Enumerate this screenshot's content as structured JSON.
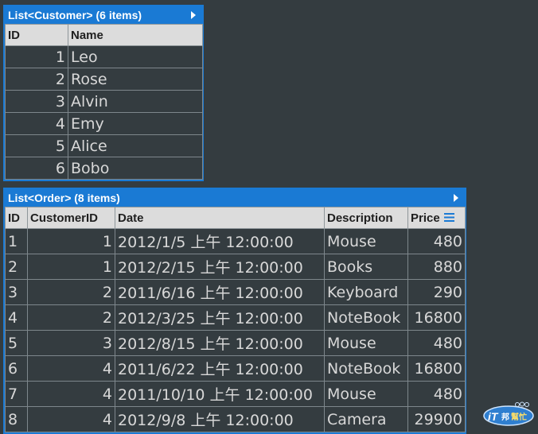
{
  "customer_panel": {
    "title": "List<Customer> (6 items)",
    "columns": [
      "ID",
      "Name"
    ],
    "rows": [
      [
        "1",
        "Leo"
      ],
      [
        "2",
        "Rose"
      ],
      [
        "3",
        "Alvin"
      ],
      [
        "4",
        "Emy"
      ],
      [
        "5",
        "Alice"
      ],
      [
        "6",
        "Bobo"
      ]
    ]
  },
  "order_panel": {
    "title": "List<Order> (8 items)",
    "columns": [
      "ID",
      "CustomerID",
      "Date",
      "Description",
      "Price"
    ],
    "rows": [
      [
        "1",
        "1",
        "2012/1/5 上午 12:00:00",
        "Mouse",
        "480"
      ],
      [
        "2",
        "1",
        "2012/2/15 上午 12:00:00",
        "Books",
        "880"
      ],
      [
        "3",
        "2",
        "2011/6/16 上午 12:00:00",
        "Keyboard",
        "290"
      ],
      [
        "4",
        "2",
        "2012/3/25 上午 12:00:00",
        "NoteBook",
        "16800"
      ],
      [
        "5",
        "3",
        "2012/8/15 上午 12:00:00",
        "Mouse",
        "480"
      ],
      [
        "6",
        "4",
        "2011/6/22 上午 12:00:00",
        "NoteBook",
        "16800"
      ],
      [
        "7",
        "4",
        "2011/10/10 上午 12:00:00",
        "Mouse",
        "480"
      ],
      [
        "8",
        "4",
        "2012/9/8 上午 12:00:00",
        "Camera",
        "29900"
      ]
    ]
  },
  "watermark": {
    "logo_text": "iT邦幫忙"
  },
  "colors": {
    "background": "#343c40",
    "accent": "#1a7ad4",
    "header_bg": "#dcdcdc"
  }
}
